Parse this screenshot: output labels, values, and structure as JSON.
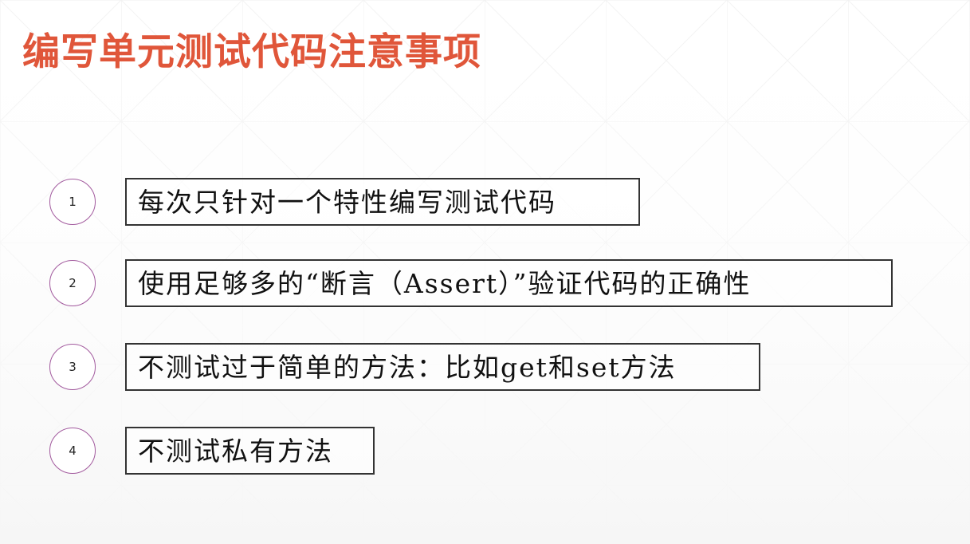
{
  "slide": {
    "title": "编写单元测试代码注意事项",
    "title_color": "#e0563a",
    "circle_color": "#a25a9e",
    "items": [
      {
        "number": "1",
        "text": "每次只针对一个特性编写测试代码"
      },
      {
        "number": "2",
        "text": "使用足够多的“断言（Assert）”验证代码的正确性"
      },
      {
        "number": "3",
        "text": "不测试过于简单的方法：比如get和set方法"
      },
      {
        "number": "4",
        "text": "不测试私有方法"
      }
    ]
  }
}
